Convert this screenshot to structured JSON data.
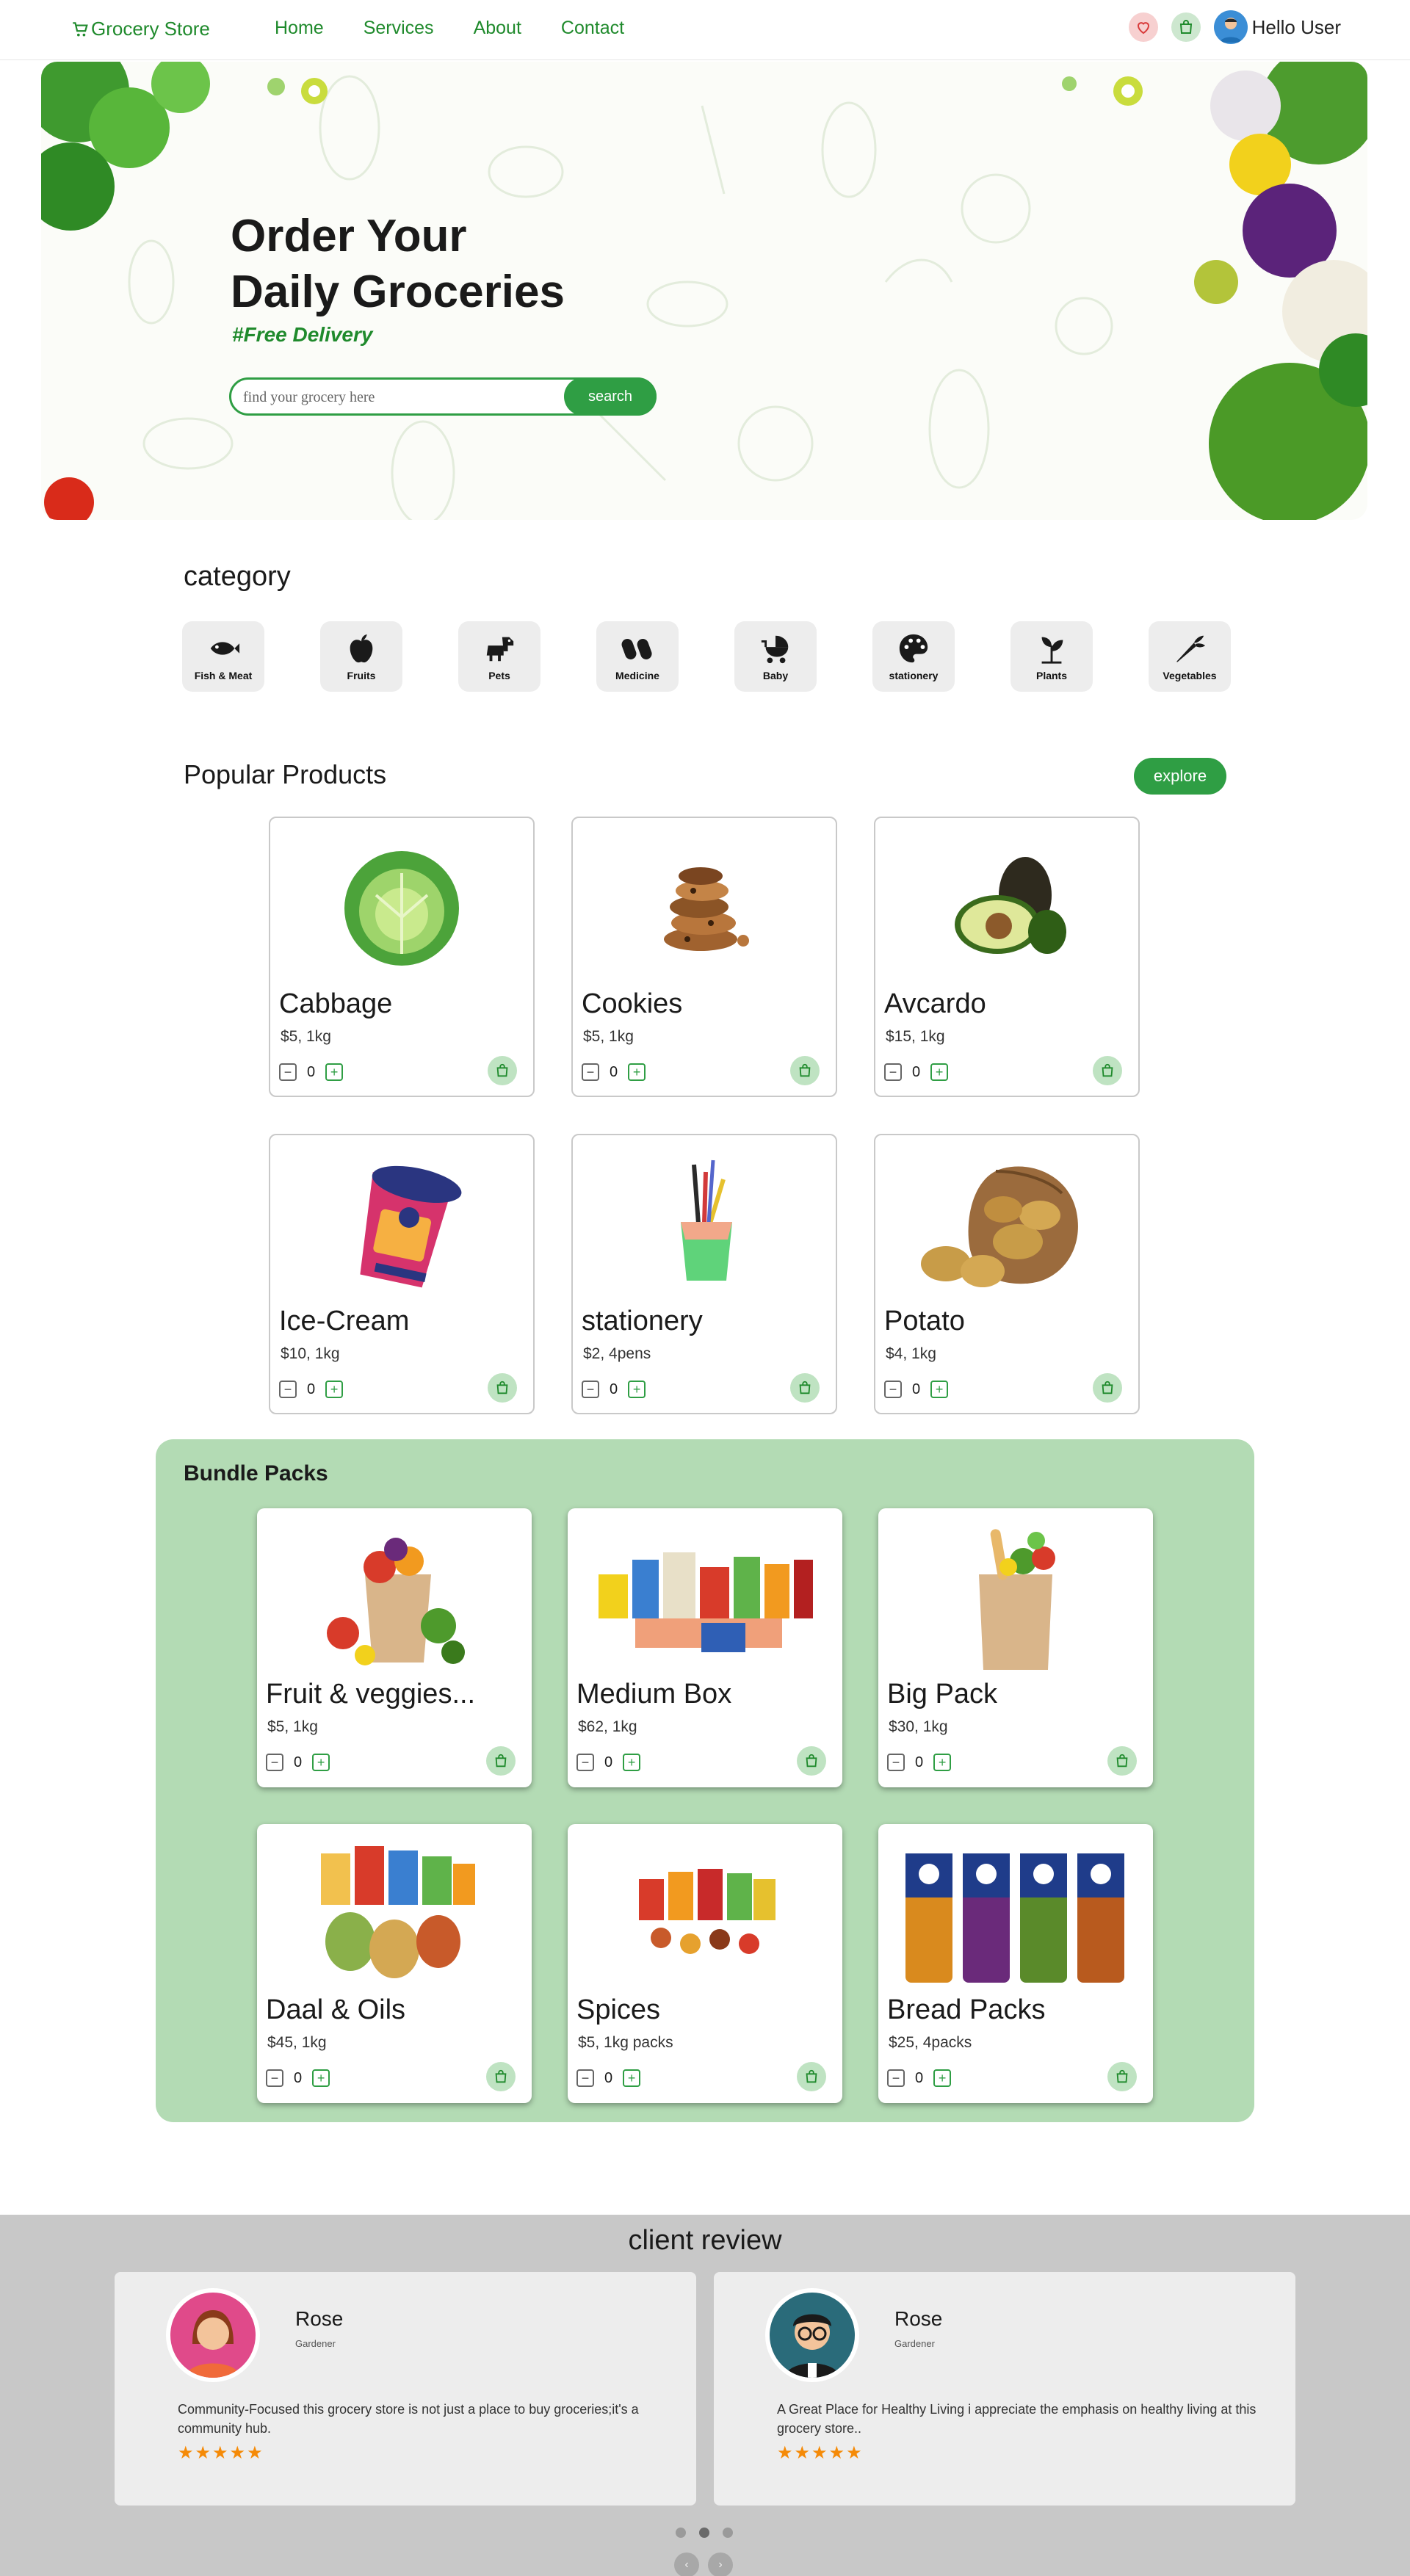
{
  "nav": {
    "brand": "Grocery Store",
    "links": [
      "Home",
      "Services",
      "About",
      "Contact"
    ],
    "greeting": "Hello User"
  },
  "hero": {
    "title_line1": "Order Your",
    "title_line2": "Daily Groceries",
    "subtitle": "#Free Delivery",
    "search_placeholder": "find your grocery here",
    "search_label": "search"
  },
  "category": {
    "title": "category",
    "items": [
      {
        "label": "Fish & Meat",
        "icon": "fish-icon"
      },
      {
        "label": "Fruits",
        "icon": "apple-icon"
      },
      {
        "label": "Pets",
        "icon": "dog-icon"
      },
      {
        "label": "Medicine",
        "icon": "pills-icon"
      },
      {
        "label": "Baby",
        "icon": "baby-carriage-icon"
      },
      {
        "label": "stationery",
        "icon": "palette-icon"
      },
      {
        "label": "Plants",
        "icon": "seedling-icon"
      },
      {
        "label": "Vegetables",
        "icon": "carrot-icon"
      }
    ]
  },
  "popular": {
    "title": "Popular Products",
    "explore_label": "explore",
    "products": [
      {
        "name": "Cabbage",
        "price": "$5, 1kg",
        "qty": "0"
      },
      {
        "name": "Cookies",
        "price": "$5, 1kg",
        "qty": "0"
      },
      {
        "name": "Avcardo",
        "price": "$15, 1kg",
        "qty": "0"
      },
      {
        "name": "Ice-Cream",
        "price": "$10, 1kg",
        "qty": "0"
      },
      {
        "name": "stationery",
        "price": "$2, 4pens",
        "qty": "0"
      },
      {
        "name": "Potato",
        "price": "$4, 1kg",
        "qty": "0"
      }
    ]
  },
  "bundle": {
    "title": "Bundle Packs",
    "products": [
      {
        "name": "Fruit & veggies...",
        "price": "$5, 1kg",
        "qty": "0"
      },
      {
        "name": "Medium Box",
        "price": "$62, 1kg",
        "qty": "0"
      },
      {
        "name": "Big Pack",
        "price": "$30, 1kg",
        "qty": "0"
      },
      {
        "name": "Daal & Oils",
        "price": "$45, 1kg",
        "qty": "0"
      },
      {
        "name": "Spices",
        "price": "$5, 1kg packs",
        "qty": "0"
      },
      {
        "name": "Bread Packs",
        "price": "$25, 4packs",
        "qty": "0"
      }
    ]
  },
  "reviews": {
    "title": "client review",
    "items": [
      {
        "name": "Rose",
        "role": "Gardener",
        "text": "Community-Focused this grocery store is not just a place to buy groceries;it's a community hub.",
        "stars": "★★★★★"
      },
      {
        "name": "Rose",
        "role": "Gardener",
        "text": "A Great Place for Healthy Living i appreciate the emphasis on healthy living at this grocery store..",
        "stars": "★★★★★"
      }
    ]
  },
  "colors": {
    "brand_green": "#2f9e44",
    "bundle_bg": "#b3dbb4",
    "review_bg": "#c8c8c8",
    "star": "#f58a07"
  }
}
